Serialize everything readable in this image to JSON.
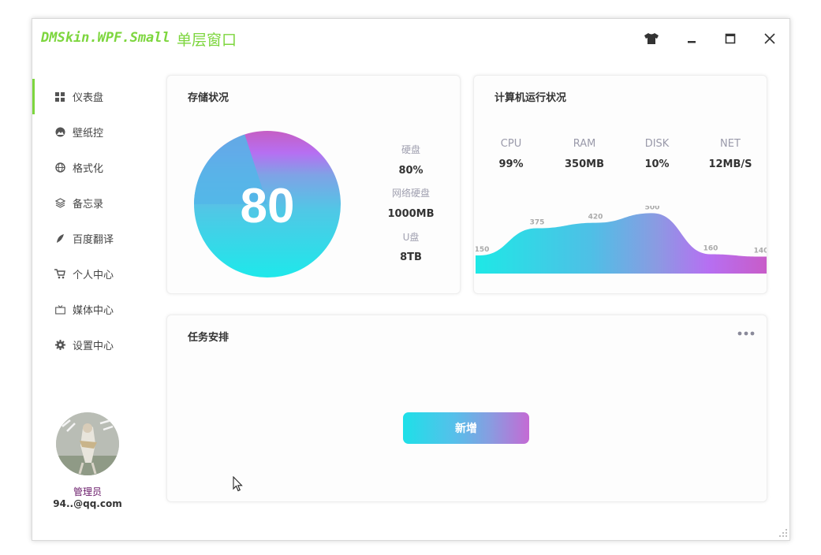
{
  "window": {
    "logo_text": "DMSkin.WPF.Small",
    "title": "单层窗口",
    "controls": [
      "shirt-icon",
      "minimize-icon",
      "maximize-icon",
      "close-icon"
    ]
  },
  "sidebar": {
    "items": [
      {
        "label": "仪表盘",
        "icon": "dashboard-icon",
        "active": true
      },
      {
        "label": "壁纸控",
        "icon": "image-icon",
        "active": false
      },
      {
        "label": "格式化",
        "icon": "globe-icon",
        "active": false
      },
      {
        "label": "备忘录",
        "icon": "layers-icon",
        "active": false
      },
      {
        "label": "百度翻译",
        "icon": "feather-icon",
        "active": false
      },
      {
        "label": "个人中心",
        "icon": "cart-icon",
        "active": false
      },
      {
        "label": "媒体中心",
        "icon": "tv-icon",
        "active": false
      },
      {
        "label": "设置中心",
        "icon": "gear-icon",
        "active": false
      }
    ],
    "user": {
      "role": "管理员",
      "email": "94..@qq.com"
    }
  },
  "storage": {
    "title": "存储状况",
    "percent": "80",
    "items": [
      {
        "label": "硬盘",
        "value": "80%"
      },
      {
        "label": "网络硬盘",
        "value": "1000MB"
      },
      {
        "label": "U盘",
        "value": "8TB"
      }
    ]
  },
  "system": {
    "title": "计算机运行状况",
    "metrics": [
      {
        "label": "CPU",
        "value": "99%"
      },
      {
        "label": "RAM",
        "value": "350MB"
      },
      {
        "label": "DISK",
        "value": "10%"
      },
      {
        "label": "NET",
        "value": "12MB/S"
      }
    ]
  },
  "chart_data": {
    "type": "area",
    "values": [
      150,
      375,
      420,
      500,
      160,
      140
    ],
    "ylim": [
      0,
      600
    ]
  },
  "tasks": {
    "title": "任务安排",
    "add_label": "新增",
    "more_icon": "more-icon"
  },
  "colors": {
    "accent": "#7dd63e",
    "gradient_start": "#1ee0e8",
    "gradient_mid": "#6aa4e4",
    "gradient_end": "#c85cc8"
  }
}
